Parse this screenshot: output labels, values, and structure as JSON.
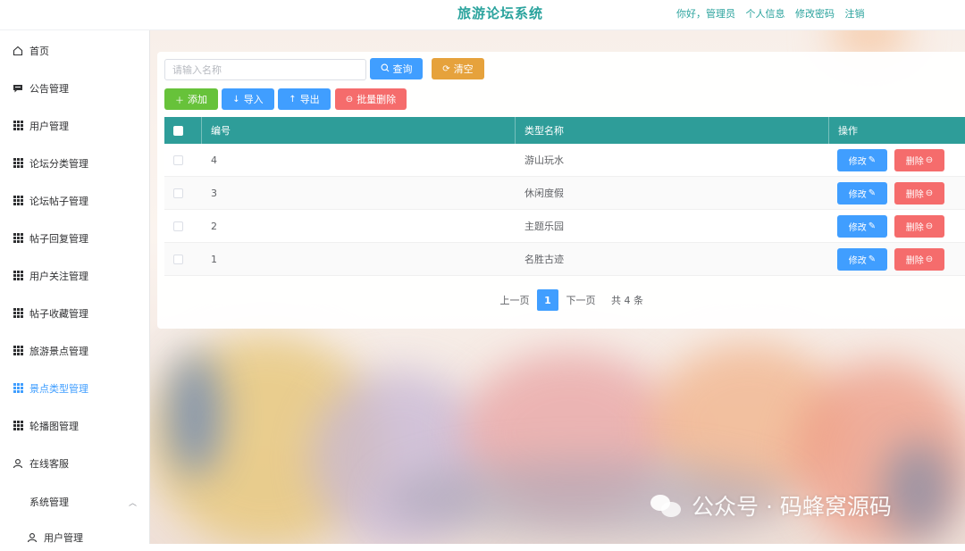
{
  "header": {
    "title": "旅游论坛系统",
    "greeting": "你好，管理员",
    "profile_link": "个人信息",
    "change_password_link": "修改密码",
    "logout_link": "注销"
  },
  "sidebar": {
    "items": [
      {
        "label": "首页",
        "icon": "home-icon"
      },
      {
        "label": "公告管理",
        "icon": "message-icon"
      },
      {
        "label": "用户管理",
        "icon": "grid-icon"
      },
      {
        "label": "论坛分类管理",
        "icon": "grid-icon"
      },
      {
        "label": "论坛帖子管理",
        "icon": "grid-icon"
      },
      {
        "label": "帖子回复管理",
        "icon": "grid-icon"
      },
      {
        "label": "用户关注管理",
        "icon": "grid-icon"
      },
      {
        "label": "帖子收藏管理",
        "icon": "grid-icon"
      },
      {
        "label": "旅游景点管理",
        "icon": "grid-icon"
      },
      {
        "label": "景点类型管理",
        "icon": "grid-icon",
        "active": true
      },
      {
        "label": "轮播图管理",
        "icon": "grid-icon"
      },
      {
        "label": "在线客服",
        "icon": "user-icon"
      },
      {
        "label": "系统管理",
        "icon": "grid4-icon"
      }
    ],
    "submenu": [
      {
        "label": "用户管理",
        "icon": "user-icon"
      }
    ]
  },
  "search": {
    "placeholder": "请输入名称",
    "value": "",
    "query_label": "查询",
    "clear_label": "清空"
  },
  "toolbar": {
    "add_label": "添加",
    "import_label": "导入",
    "export_label": "导出",
    "batch_delete_label": "批量删除"
  },
  "table": {
    "columns": [
      "编号",
      "类型名称",
      "操作"
    ],
    "rows": [
      {
        "id": "4",
        "name": "游山玩水"
      },
      {
        "id": "3",
        "name": "休闲度假"
      },
      {
        "id": "2",
        "name": "主题乐园"
      },
      {
        "id": "1",
        "name": "名胜古迹"
      }
    ],
    "edit_label": "修改",
    "delete_label": "删除"
  },
  "pagination": {
    "prev_label": "上一页",
    "current_page": "1",
    "next_label": "下一页",
    "total_text": "共 4 条"
  },
  "watermark": {
    "text": "公众号 · 码蜂窝源码"
  },
  "colors": {
    "brand": "#2aa39d",
    "table_header": "#2e9d99",
    "primary": "#409eff",
    "warning": "#e6a23c",
    "success": "#67c23a",
    "danger": "#f56c6c"
  }
}
